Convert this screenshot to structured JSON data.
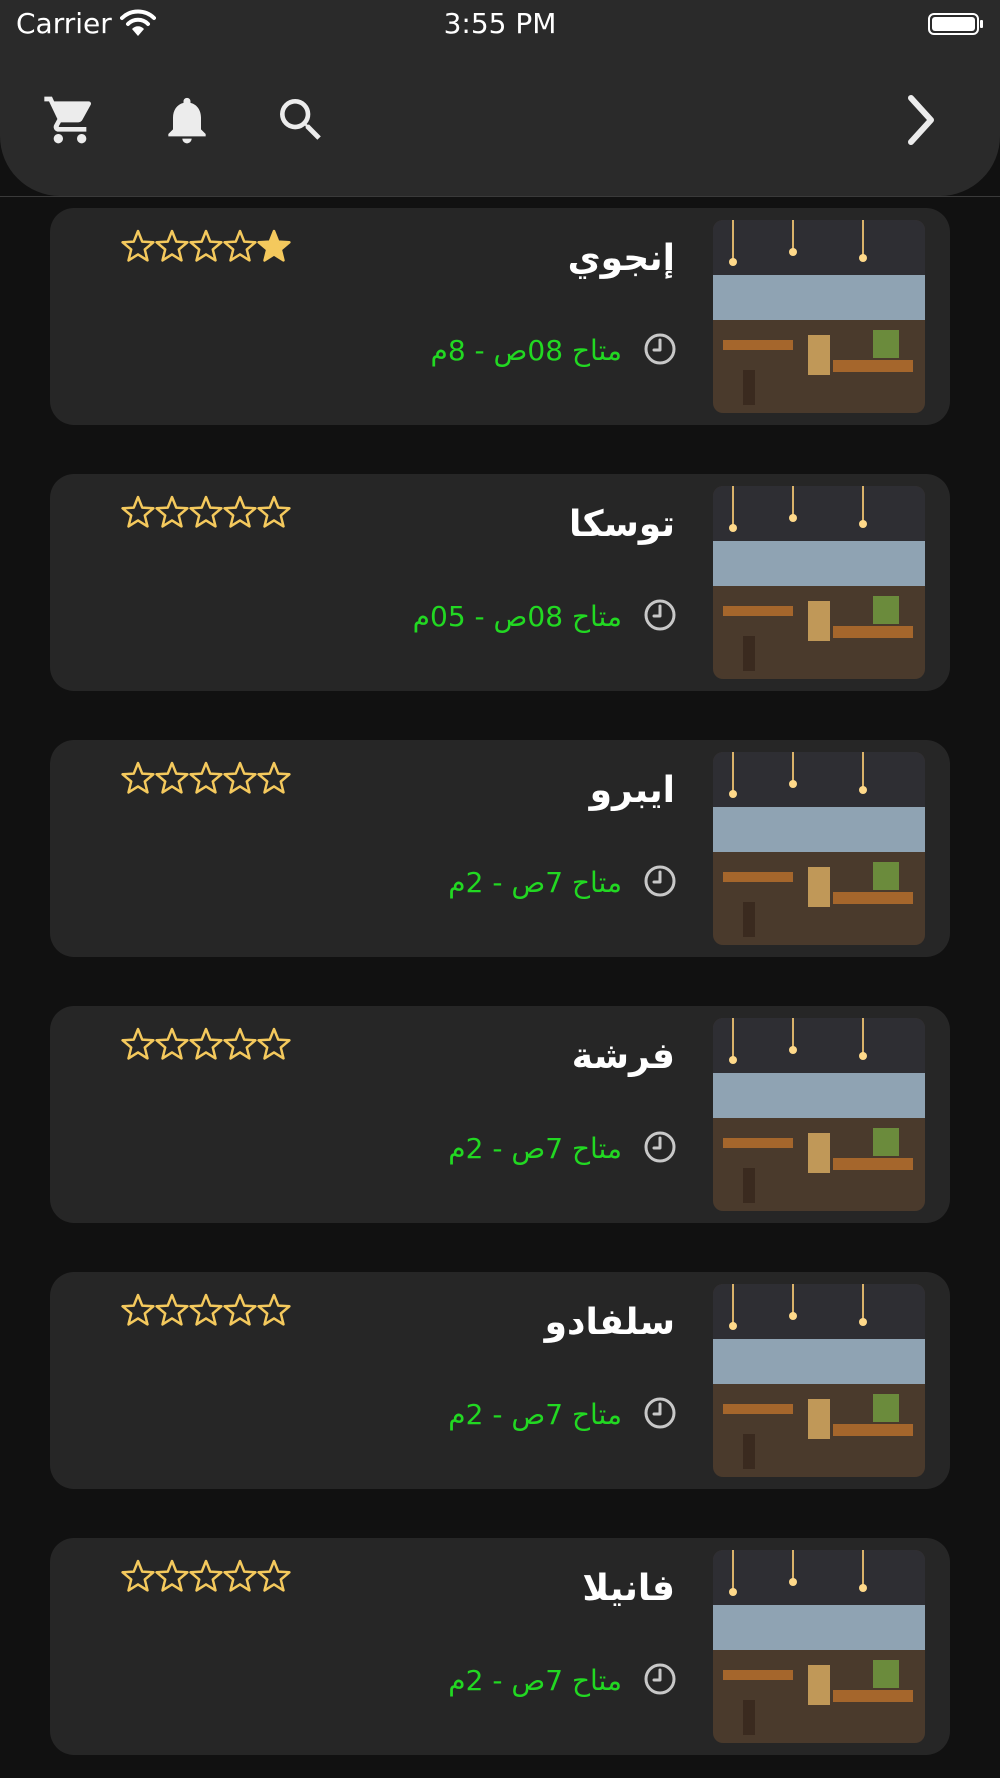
{
  "status_bar": {
    "carrier": "Carrier",
    "time": "3:55 PM"
  },
  "header": {
    "icons": [
      "cart-icon",
      "bell-icon",
      "search-icon",
      "chevron-right-icon"
    ]
  },
  "colors": {
    "background": "#111111",
    "header": "#2a2a2a",
    "card": "#262626",
    "hours_text": "#22d822",
    "star": "#f4c95d"
  },
  "restaurants": [
    {
      "name": "إنجوي",
      "hours": "متاح 08ص - 8م",
      "rating": 1,
      "max_rating": 5,
      "image": "restaurant-photo"
    },
    {
      "name": "توسكا",
      "hours": "متاح 08ص - 05م",
      "rating": 0,
      "max_rating": 5,
      "image": "restaurant-photo"
    },
    {
      "name": "ايبرو",
      "hours": "متاح 7ص - 2م",
      "rating": 0,
      "max_rating": 5,
      "image": "restaurant-photo"
    },
    {
      "name": "فرشة",
      "hours": "متاح 7ص - 2م",
      "rating": 0,
      "max_rating": 5,
      "image": "restaurant-photo"
    },
    {
      "name": "سلفادو",
      "hours": "متاح 7ص - 2م",
      "rating": 0,
      "max_rating": 5,
      "image": "restaurant-photo"
    },
    {
      "name": "فانيلا",
      "hours": "متاح 7ص - 2م",
      "rating": 0,
      "max_rating": 5,
      "image": "restaurant-photo"
    }
  ]
}
